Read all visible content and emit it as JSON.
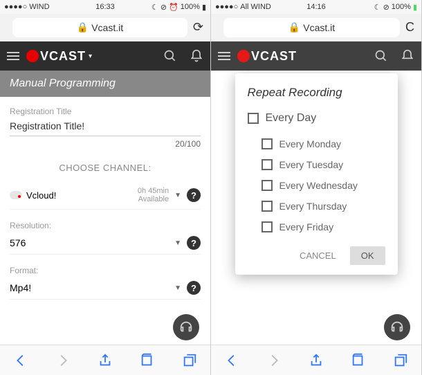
{
  "left": {
    "status": {
      "carrier": "WIND",
      "time": "16:33",
      "battery": "100%"
    },
    "url": "Vcast.it",
    "brand": "VCAST",
    "subheader": "Manual Programming",
    "reg_title_label": "Registration Title",
    "reg_title_value": "Registration Title!",
    "counter": "20/100",
    "choose_channel": "CHOOSE CHANNEL:",
    "channel_name": "Vcloud!",
    "avail_line1": "0h 45min",
    "avail_line2": "Available",
    "resolution_label": "Resolution:",
    "resolution_value": "576",
    "format_label": "Format:",
    "format_value": "Mp4!"
  },
  "right": {
    "status": {
      "carrier": "All WIND",
      "time": "14:16",
      "battery": "100%"
    },
    "url": "Vcast.it",
    "brand": "VCAST",
    "modal": {
      "title": "Repeat Recording",
      "every_day": "Every Day",
      "days": [
        "Every Monday",
        "Every Tuesday",
        "Every Wednesday",
        "Every Thursday",
        "Every Friday"
      ],
      "cancel": "CANCEL",
      "ok": "OK"
    }
  }
}
